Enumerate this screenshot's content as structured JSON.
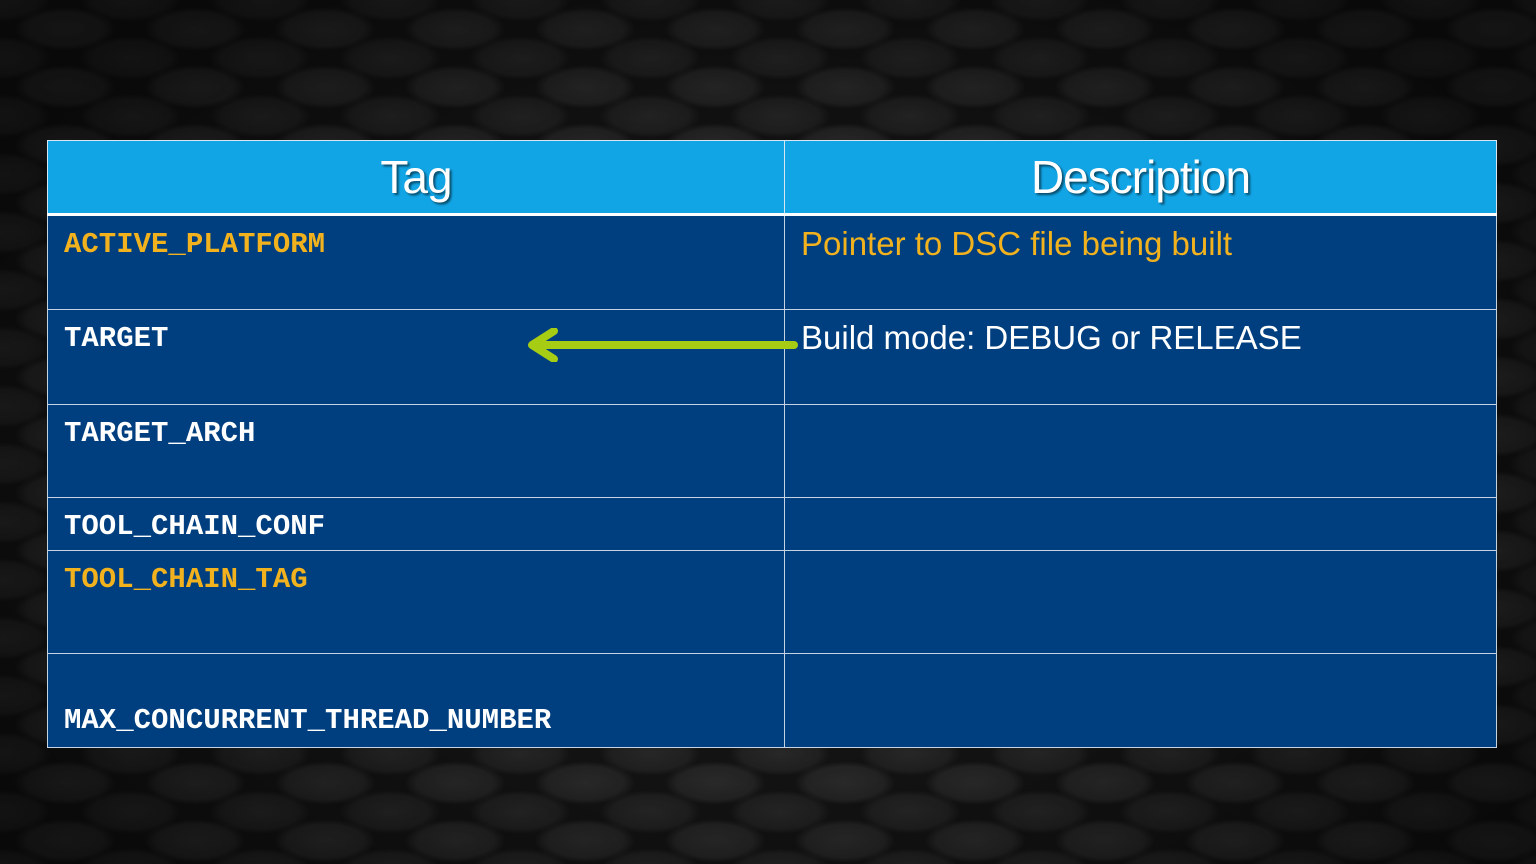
{
  "table": {
    "headers": {
      "tag": "Tag",
      "description": "Description"
    },
    "rows": [
      {
        "tag": "ACTIVE_PLATFORM",
        "description": "Pointer to DSC file being built",
        "highlighted": true
      },
      {
        "tag": "TARGET",
        "description": "Build mode: DEBUG or RELEASE",
        "highlighted": false,
        "arrow": "arrow-left-icon"
      },
      {
        "tag": "TARGET_ARCH",
        "description": "",
        "highlighted": false
      },
      {
        "tag": "TOOL_CHAIN_CONF",
        "description": "",
        "highlighted": false
      },
      {
        "tag": "TOOL_CHAIN_TAG",
        "description": "",
        "highlighted": true
      },
      {
        "tag": "MAX_CONCURRENT_THREAD_NUMBER",
        "description": "",
        "highlighted": false
      }
    ]
  },
  "colors": {
    "header_background": "#12a5e6",
    "row_background": "#003f7f",
    "highlight_text": "#f2b21e",
    "arrow": "#a6cc14"
  }
}
